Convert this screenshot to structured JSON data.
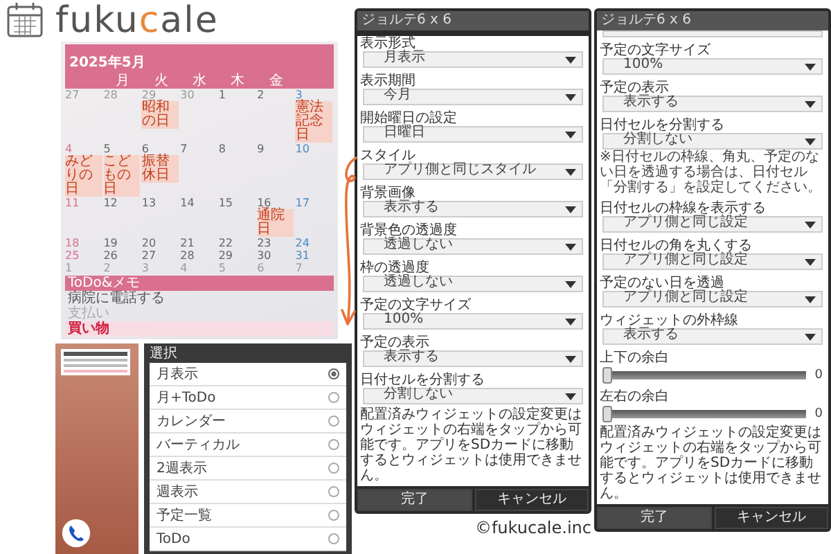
{
  "logo": {
    "parts": [
      {
        "text": "fuku",
        "color": "#555555"
      },
      {
        "text": "c",
        "color": "#e8883a"
      },
      {
        "text": "ale",
        "color": "#555555"
      }
    ]
  },
  "calendar_widget": {
    "title": "2025年5月",
    "weekdays": [
      "月",
      "火",
      "水",
      "木",
      "金"
    ],
    "weeks": [
      [
        {
          "day": "27",
          "muted": true
        },
        {
          "day": "28",
          "muted": true
        },
        {
          "day": "29",
          "muted": true,
          "event": "昭和の日"
        },
        {
          "day": "30",
          "muted": true
        },
        {
          "day": "1",
          "muted": false
        },
        {
          "day": "2",
          "muted": false
        },
        {
          "day": "3",
          "muted": false,
          "event": "憲法記念日"
        }
      ],
      [
        {
          "day": "4",
          "muted": false,
          "event": "みどりの日"
        },
        {
          "day": "5",
          "muted": false,
          "event": "こどもの日"
        },
        {
          "day": "6",
          "muted": false,
          "event": "振替休日"
        },
        {
          "day": "7",
          "muted": false
        },
        {
          "day": "8",
          "muted": false
        },
        {
          "day": "9",
          "muted": false
        },
        {
          "day": "10",
          "muted": false
        }
      ],
      [
        {
          "day": "11",
          "muted": false
        },
        {
          "day": "12",
          "muted": false
        },
        {
          "day": "13",
          "muted": false
        },
        {
          "day": "14",
          "muted": false
        },
        {
          "day": "15",
          "muted": false
        },
        {
          "day": "16",
          "muted": false,
          "event": "通院日"
        },
        {
          "day": "17",
          "muted": false
        }
      ],
      [
        {
          "day": "18",
          "muted": false
        },
        {
          "day": "19",
          "muted": false
        },
        {
          "day": "20",
          "muted": false
        },
        {
          "day": "21",
          "muted": false
        },
        {
          "day": "22",
          "muted": false
        },
        {
          "day": "23",
          "muted": false
        },
        {
          "day": "24",
          "muted": false
        }
      ],
      [
        {
          "day": "25",
          "muted": false
        },
        {
          "day": "26",
          "muted": false
        },
        {
          "day": "27",
          "muted": false
        },
        {
          "day": "28",
          "muted": false
        },
        {
          "day": "29",
          "muted": false
        },
        {
          "day": "30",
          "muted": false
        },
        {
          "day": "31",
          "muted": false
        }
      ],
      [
        {
          "day": "1",
          "muted": true
        },
        {
          "day": "2",
          "muted": true
        },
        {
          "day": "3",
          "muted": true
        },
        {
          "day": "4",
          "muted": true
        },
        {
          "day": "5",
          "muted": true
        },
        {
          "day": "6",
          "muted": true
        },
        {
          "day": "7",
          "muted": true
        }
      ]
    ],
    "todo": {
      "heading": "ToDo&メモ",
      "items": [
        {
          "text": "病院に電話する",
          "kind": "normal"
        },
        {
          "text": "支払い",
          "kind": "faded"
        },
        {
          "text": "買い物",
          "kind": "important"
        }
      ]
    }
  },
  "select_dialog": {
    "title": "選択",
    "options": [
      {
        "label": "月表示",
        "selected": true
      },
      {
        "label": "月+ToDo",
        "selected": false
      },
      {
        "label": "カレンダー",
        "selected": false
      },
      {
        "label": "バーティカル",
        "selected": false
      },
      {
        "label": "2週表示",
        "selected": false
      },
      {
        "label": "週表示",
        "selected": false
      },
      {
        "label": "予定一覧",
        "selected": false
      },
      {
        "label": "ToDo",
        "selected": false
      }
    ]
  },
  "settings_panels": [
    {
      "title": "ジョルテ6 x 6",
      "rows": [
        {
          "kind": "dropdown",
          "label": "表示形式",
          "value": "月表示"
        },
        {
          "kind": "dropdown",
          "label": "表示期間",
          "value": "今月"
        },
        {
          "kind": "dropdown",
          "label": "開始曜日の設定",
          "value": "日曜日"
        },
        {
          "kind": "dropdown",
          "label": "スタイル",
          "value": "アプリ側と同じスタイル"
        },
        {
          "kind": "dropdown",
          "label": "背景画像",
          "value": "表示する"
        },
        {
          "kind": "dropdown",
          "label": "背景色の透過度",
          "value": "透過しない"
        },
        {
          "kind": "dropdown",
          "label": "枠の透過度",
          "value": "透過しない"
        },
        {
          "kind": "dropdown",
          "label": "予定の文字サイズ",
          "value": "100%"
        },
        {
          "kind": "dropdown",
          "label": "予定の表示",
          "value": "表示する"
        },
        {
          "kind": "dropdown",
          "label": "日付セルを分割する",
          "value": "分割しない"
        }
      ],
      "notice": "配置済みウィジェットの設定変更はウィジェットの右端をタップから可能です。アプリをSDカードに移動するとウィジェットは使用できません。",
      "buttons": [
        "完了",
        "キャンセル"
      ]
    },
    {
      "title": "ジョルテ6 x 6",
      "rows": [
        {
          "kind": "cut"
        },
        {
          "kind": "dropdown",
          "label": "予定の文字サイズ",
          "value": "100%"
        },
        {
          "kind": "dropdown",
          "label": "予定の表示",
          "value": "表示する"
        },
        {
          "kind": "dropdown",
          "label": "日付セルを分割する",
          "value": "分割しない"
        },
        {
          "kind": "note",
          "text": "※日付セルの枠線、角丸、予定のない日を透過する場合は、日付セル「分割する」を設定してください。"
        },
        {
          "kind": "dropdown",
          "label": "日付セルの枠線を表示する",
          "value": "アプリ側と同じ設定"
        },
        {
          "kind": "dropdown",
          "label": "日付セルの角を丸くする",
          "value": "アプリ側と同じ設定"
        },
        {
          "kind": "dropdown",
          "label": "予定のない日を透過",
          "value": "アプリ側と同じ設定"
        },
        {
          "kind": "dropdown",
          "label": "ウィジェットの外枠線",
          "value": "表示する"
        },
        {
          "kind": "slider",
          "label": "上下の余白",
          "level": 0,
          "reading": "0"
        },
        {
          "kind": "slider",
          "label": "左右の余白",
          "level": 0,
          "reading": "0"
        }
      ],
      "notice": "配置済みウィジェットの設定変更はウィジェットの右端をタップから可能です。アプリをSDカードに移動するとウィジェットは使用できません。",
      "buttons": [
        "完了",
        "キャンセル"
      ]
    }
  ],
  "copyright": "©fukucale.inc"
}
